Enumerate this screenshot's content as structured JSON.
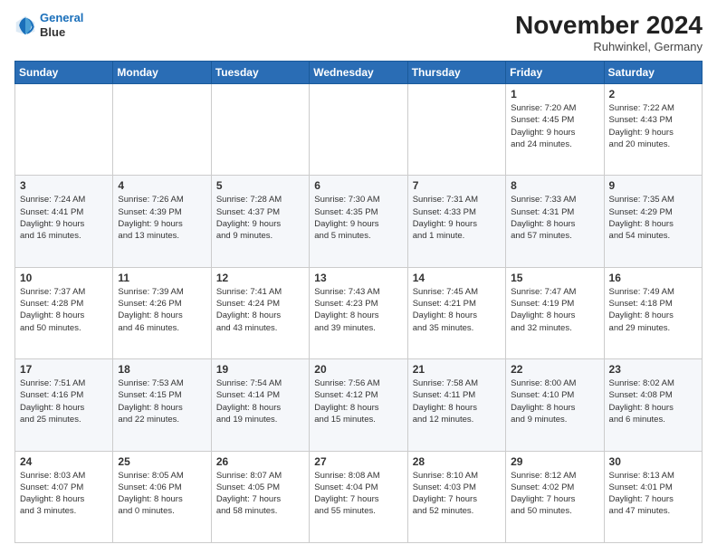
{
  "logo": {
    "line1": "General",
    "line2": "Blue"
  },
  "title": "November 2024",
  "location": "Ruhwinkel, Germany",
  "days_header": [
    "Sunday",
    "Monday",
    "Tuesday",
    "Wednesday",
    "Thursday",
    "Friday",
    "Saturday"
  ],
  "weeks": [
    [
      {
        "day": "",
        "info": ""
      },
      {
        "day": "",
        "info": ""
      },
      {
        "day": "",
        "info": ""
      },
      {
        "day": "",
        "info": ""
      },
      {
        "day": "",
        "info": ""
      },
      {
        "day": "1",
        "info": "Sunrise: 7:20 AM\nSunset: 4:45 PM\nDaylight: 9 hours\nand 24 minutes."
      },
      {
        "day": "2",
        "info": "Sunrise: 7:22 AM\nSunset: 4:43 PM\nDaylight: 9 hours\nand 20 minutes."
      }
    ],
    [
      {
        "day": "3",
        "info": "Sunrise: 7:24 AM\nSunset: 4:41 PM\nDaylight: 9 hours\nand 16 minutes."
      },
      {
        "day": "4",
        "info": "Sunrise: 7:26 AM\nSunset: 4:39 PM\nDaylight: 9 hours\nand 13 minutes."
      },
      {
        "day": "5",
        "info": "Sunrise: 7:28 AM\nSunset: 4:37 PM\nDaylight: 9 hours\nand 9 minutes."
      },
      {
        "day": "6",
        "info": "Sunrise: 7:30 AM\nSunset: 4:35 PM\nDaylight: 9 hours\nand 5 minutes."
      },
      {
        "day": "7",
        "info": "Sunrise: 7:31 AM\nSunset: 4:33 PM\nDaylight: 9 hours\nand 1 minute."
      },
      {
        "day": "8",
        "info": "Sunrise: 7:33 AM\nSunset: 4:31 PM\nDaylight: 8 hours\nand 57 minutes."
      },
      {
        "day": "9",
        "info": "Sunrise: 7:35 AM\nSunset: 4:29 PM\nDaylight: 8 hours\nand 54 minutes."
      }
    ],
    [
      {
        "day": "10",
        "info": "Sunrise: 7:37 AM\nSunset: 4:28 PM\nDaylight: 8 hours\nand 50 minutes."
      },
      {
        "day": "11",
        "info": "Sunrise: 7:39 AM\nSunset: 4:26 PM\nDaylight: 8 hours\nand 46 minutes."
      },
      {
        "day": "12",
        "info": "Sunrise: 7:41 AM\nSunset: 4:24 PM\nDaylight: 8 hours\nand 43 minutes."
      },
      {
        "day": "13",
        "info": "Sunrise: 7:43 AM\nSunset: 4:23 PM\nDaylight: 8 hours\nand 39 minutes."
      },
      {
        "day": "14",
        "info": "Sunrise: 7:45 AM\nSunset: 4:21 PM\nDaylight: 8 hours\nand 35 minutes."
      },
      {
        "day": "15",
        "info": "Sunrise: 7:47 AM\nSunset: 4:19 PM\nDaylight: 8 hours\nand 32 minutes."
      },
      {
        "day": "16",
        "info": "Sunrise: 7:49 AM\nSunset: 4:18 PM\nDaylight: 8 hours\nand 29 minutes."
      }
    ],
    [
      {
        "day": "17",
        "info": "Sunrise: 7:51 AM\nSunset: 4:16 PM\nDaylight: 8 hours\nand 25 minutes."
      },
      {
        "day": "18",
        "info": "Sunrise: 7:53 AM\nSunset: 4:15 PM\nDaylight: 8 hours\nand 22 minutes."
      },
      {
        "day": "19",
        "info": "Sunrise: 7:54 AM\nSunset: 4:14 PM\nDaylight: 8 hours\nand 19 minutes."
      },
      {
        "day": "20",
        "info": "Sunrise: 7:56 AM\nSunset: 4:12 PM\nDaylight: 8 hours\nand 15 minutes."
      },
      {
        "day": "21",
        "info": "Sunrise: 7:58 AM\nSunset: 4:11 PM\nDaylight: 8 hours\nand 12 minutes."
      },
      {
        "day": "22",
        "info": "Sunrise: 8:00 AM\nSunset: 4:10 PM\nDaylight: 8 hours\nand 9 minutes."
      },
      {
        "day": "23",
        "info": "Sunrise: 8:02 AM\nSunset: 4:08 PM\nDaylight: 8 hours\nand 6 minutes."
      }
    ],
    [
      {
        "day": "24",
        "info": "Sunrise: 8:03 AM\nSunset: 4:07 PM\nDaylight: 8 hours\nand 3 minutes."
      },
      {
        "day": "25",
        "info": "Sunrise: 8:05 AM\nSunset: 4:06 PM\nDaylight: 8 hours\nand 0 minutes."
      },
      {
        "day": "26",
        "info": "Sunrise: 8:07 AM\nSunset: 4:05 PM\nDaylight: 7 hours\nand 58 minutes."
      },
      {
        "day": "27",
        "info": "Sunrise: 8:08 AM\nSunset: 4:04 PM\nDaylight: 7 hours\nand 55 minutes."
      },
      {
        "day": "28",
        "info": "Sunrise: 8:10 AM\nSunset: 4:03 PM\nDaylight: 7 hours\nand 52 minutes."
      },
      {
        "day": "29",
        "info": "Sunrise: 8:12 AM\nSunset: 4:02 PM\nDaylight: 7 hours\nand 50 minutes."
      },
      {
        "day": "30",
        "info": "Sunrise: 8:13 AM\nSunset: 4:01 PM\nDaylight: 7 hours\nand 47 minutes."
      }
    ]
  ]
}
